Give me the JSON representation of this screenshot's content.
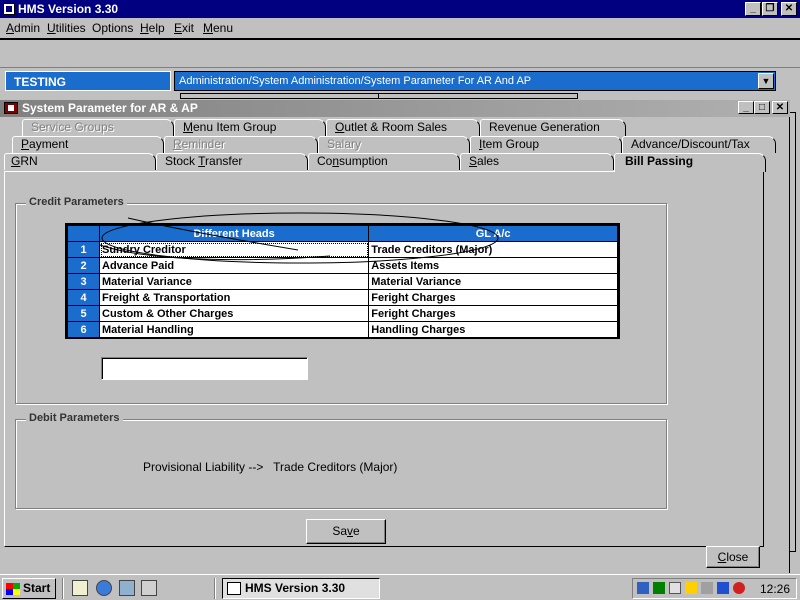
{
  "window": {
    "title": "HMS Version 3.30",
    "controls": {
      "minimize": "_",
      "maximize": "❐",
      "close": "✕"
    }
  },
  "menu": {
    "items": [
      {
        "label": "Admin",
        "u": "A",
        "rest": "dmin"
      },
      {
        "label": "Utilities",
        "u": "U",
        "rest": "tilities"
      },
      {
        "label": "Options",
        "u": "",
        "rest": "Options"
      },
      {
        "label": "Help",
        "u": "H",
        "rest": "elp"
      },
      {
        "label": "Exit",
        "u": "E",
        "rest": "xit"
      },
      {
        "label": "Menu",
        "u": "M",
        "rest": "enu"
      }
    ]
  },
  "status": {
    "environment": "TESTING",
    "path": "Administration/System Administration/System Parameter For AR And AP"
  },
  "child_window": {
    "title": "System Parameter for AR & AP",
    "controls": {
      "minimize": "_",
      "maximize": "□",
      "close": "✕"
    }
  },
  "tabs": {
    "row1": [
      {
        "label": "Service Groups",
        "disabled": true
      },
      {
        "label": "Menu Item Group",
        "u": "M",
        "rest": "enu Item Group"
      },
      {
        "label": "Outlet & Room Sales",
        "u": "O",
        "rest": "utlet & Room Sales"
      },
      {
        "label": "Revenue Generation"
      }
    ],
    "row2": [
      {
        "label": "Payment",
        "u": "P",
        "rest": "ayment"
      },
      {
        "label": "Reminder",
        "u": "R",
        "rest": "eminder",
        "disabled": true
      },
      {
        "label": "Salary",
        "disabled": true
      },
      {
        "label": "Item Group",
        "u": "I",
        "rest": "tem Group"
      },
      {
        "label": "Advance/Discount/Tax"
      }
    ],
    "row3": [
      {
        "label": "GRN",
        "u": "G",
        "rest": "RN"
      },
      {
        "label": "Stock Transfer",
        "pre": "Stock ",
        "u": "T",
        "rest": "ransfer"
      },
      {
        "label": "Consumption",
        "pre": "Co",
        "u": "n",
        "rest": "sumption"
      },
      {
        "label": "Sales",
        "u": "S",
        "rest": "ales"
      },
      {
        "label": "Bill Passing",
        "active": true
      }
    ]
  },
  "credit": {
    "group_label": "Credit Parameters",
    "columns": [
      "Different Heads",
      "GL A/c"
    ],
    "rows": [
      {
        "num": "1",
        "head": "Sundry Creditor",
        "gl": "Trade Creditors (Major)"
      },
      {
        "num": "2",
        "head": "Advance Paid",
        "gl": "Assets Items"
      },
      {
        "num": "3",
        "head": "Material Variance",
        "gl": "Material Variance"
      },
      {
        "num": "4",
        "head": "Freight & Transportation",
        "gl": "Feright Charges"
      },
      {
        "num": "5",
        "head": "Custom & Other Charges",
        "gl": "Feright Charges"
      },
      {
        "num": "6",
        "head": "Material Handling",
        "gl": "Handling Charges"
      }
    ],
    "input_value": ""
  },
  "debit": {
    "group_label": "Debit Parameters",
    "text": "Provisional Liability -->   Trade Creditors (Major)"
  },
  "buttons": {
    "save": {
      "label": "Save",
      "pre": "Sa",
      "u": "v",
      "rest": "e"
    },
    "close": {
      "label": "Close",
      "u": "C",
      "rest": "lose"
    }
  },
  "taskbar": {
    "start": "Start",
    "task": "HMS Version 3.30",
    "clock": "12:26"
  },
  "colors": {
    "titlebar": "#000080",
    "grid_header": "#1a6dcc",
    "face": "#c0c0c0"
  }
}
